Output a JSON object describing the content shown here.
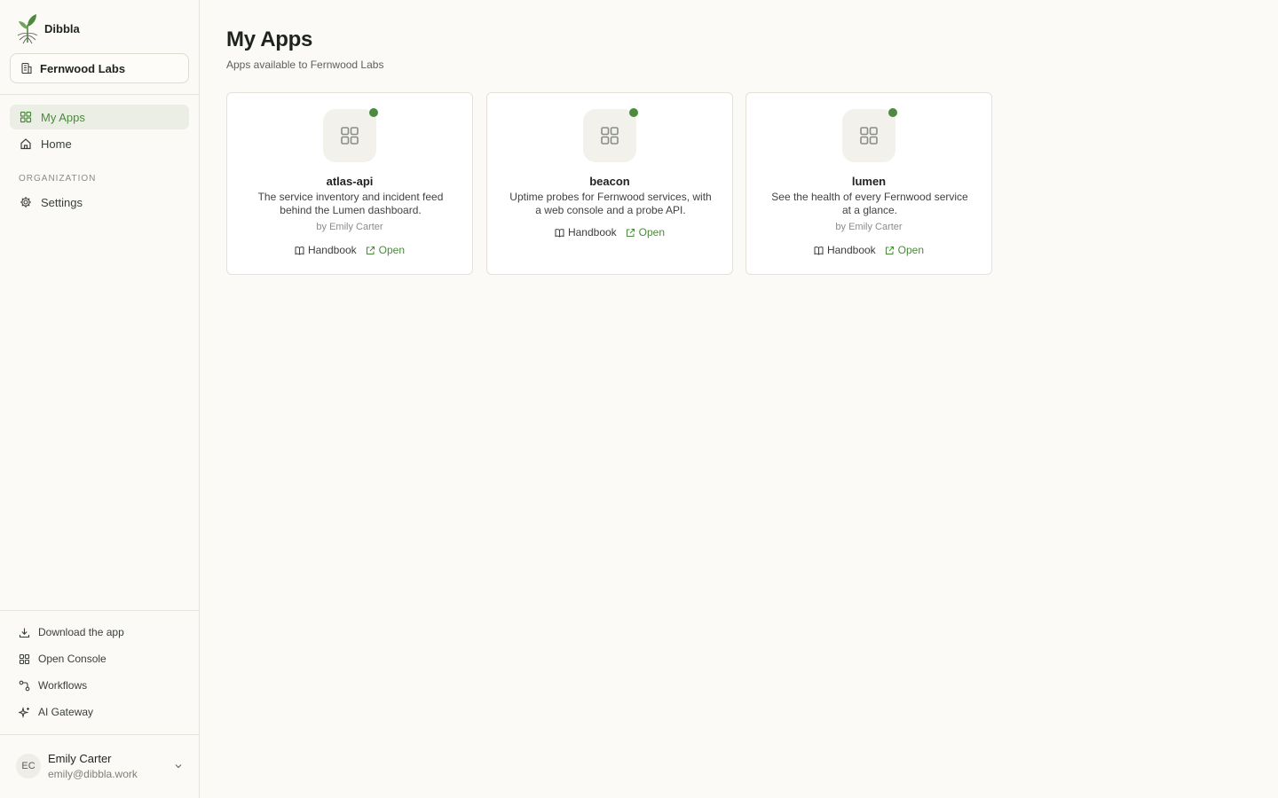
{
  "brand": {
    "name": "Dibbla"
  },
  "org": {
    "name": "Fernwood Labs"
  },
  "nav": {
    "items": [
      {
        "label": "My Apps",
        "icon": "grid-icon",
        "active": true
      },
      {
        "label": "Home",
        "icon": "home-icon",
        "active": false
      }
    ],
    "section_label": "ORGANIZATION",
    "org_items": [
      {
        "label": "Settings",
        "icon": "gear-icon"
      }
    ]
  },
  "utilities": [
    {
      "label": "Download the app",
      "icon": "download-icon"
    },
    {
      "label": "Open Console",
      "icon": "grid-icon"
    },
    {
      "label": "Workflows",
      "icon": "workflow-icon"
    },
    {
      "label": "AI Gateway",
      "icon": "sparkle-icon"
    }
  ],
  "user": {
    "initials": "EC",
    "name": "Emily Carter",
    "email": "emily@dibbla.work"
  },
  "page": {
    "title": "My Apps",
    "subtitle": "Apps available to Fernwood Labs"
  },
  "apps": [
    {
      "name": "atlas-api",
      "description": "The service inventory and incident feed behind the Lumen dashboard.",
      "author": "by Emily Carter",
      "handbook_label": "Handbook",
      "open_label": "Open",
      "status": "online"
    },
    {
      "name": "beacon",
      "description": "Uptime probes for Fernwood services, with a web console and a probe API.",
      "author": "",
      "handbook_label": "Handbook",
      "open_label": "Open",
      "status": "online"
    },
    {
      "name": "lumen",
      "description": "See the health of every Fernwood service at a glance.",
      "author": "by Emily Carter",
      "handbook_label": "Handbook",
      "open_label": "Open",
      "status": "online"
    }
  ],
  "colors": {
    "accent": "#4b8a3c",
    "status_online": "#4d8a3f",
    "background": "#fbfaf6",
    "active_nav_bg": "#ebeee4"
  }
}
